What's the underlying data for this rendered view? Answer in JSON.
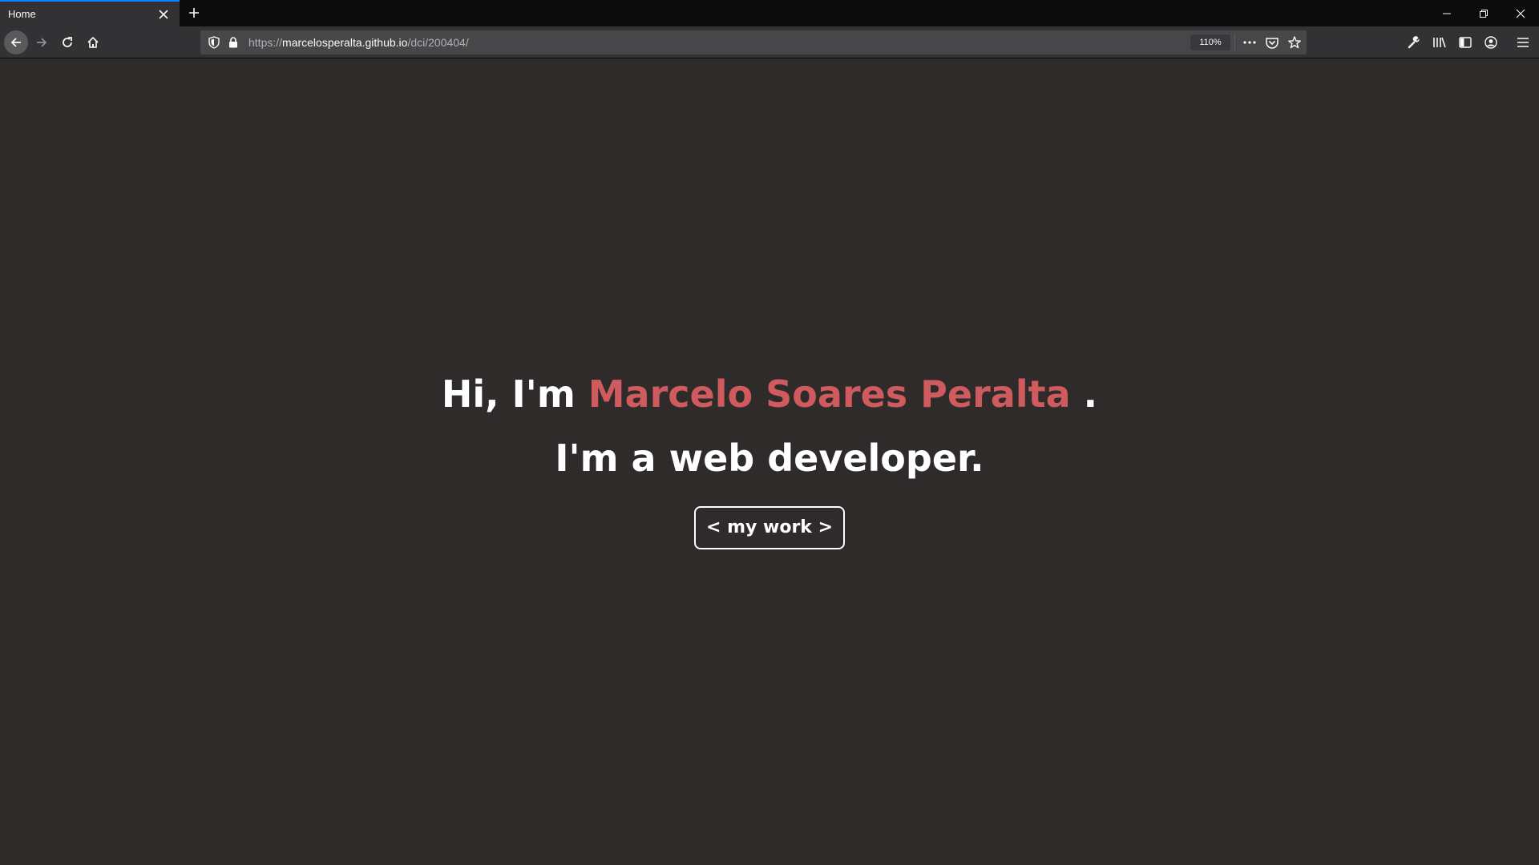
{
  "browser": {
    "tab_title": "Home",
    "url_scheme": "https://",
    "url_host": "marcelosperalta.github.io",
    "url_path": "/dci/200404/",
    "zoom": "110%",
    "accent_color": "#0a84ff"
  },
  "page": {
    "greeting": "Hi, I'm",
    "name": "Marcelo Soares Peralta",
    "period": ".",
    "tagline": "I'm a web developer.",
    "button_label": "< my work >",
    "name_color": "#cf5b5f",
    "background_color": "#2f2b2b"
  },
  "icons": {
    "tab_close": "close-icon",
    "new_tab": "plus-icon",
    "back": "arrow-left-icon",
    "forward": "arrow-right-icon",
    "reload": "reload-icon",
    "home": "home-icon",
    "tracking": "shield-icon",
    "lock": "lock-icon",
    "page_actions": "more-icon",
    "pocket": "pocket-icon",
    "bookmark": "star-icon",
    "devtools": "wrench-icon",
    "library": "library-icon",
    "sidebar": "sidebar-icon",
    "account": "account-icon",
    "menu": "hamburger-icon",
    "minimize": "minimize-icon",
    "restore": "restore-icon",
    "close_window": "close-window-icon"
  }
}
